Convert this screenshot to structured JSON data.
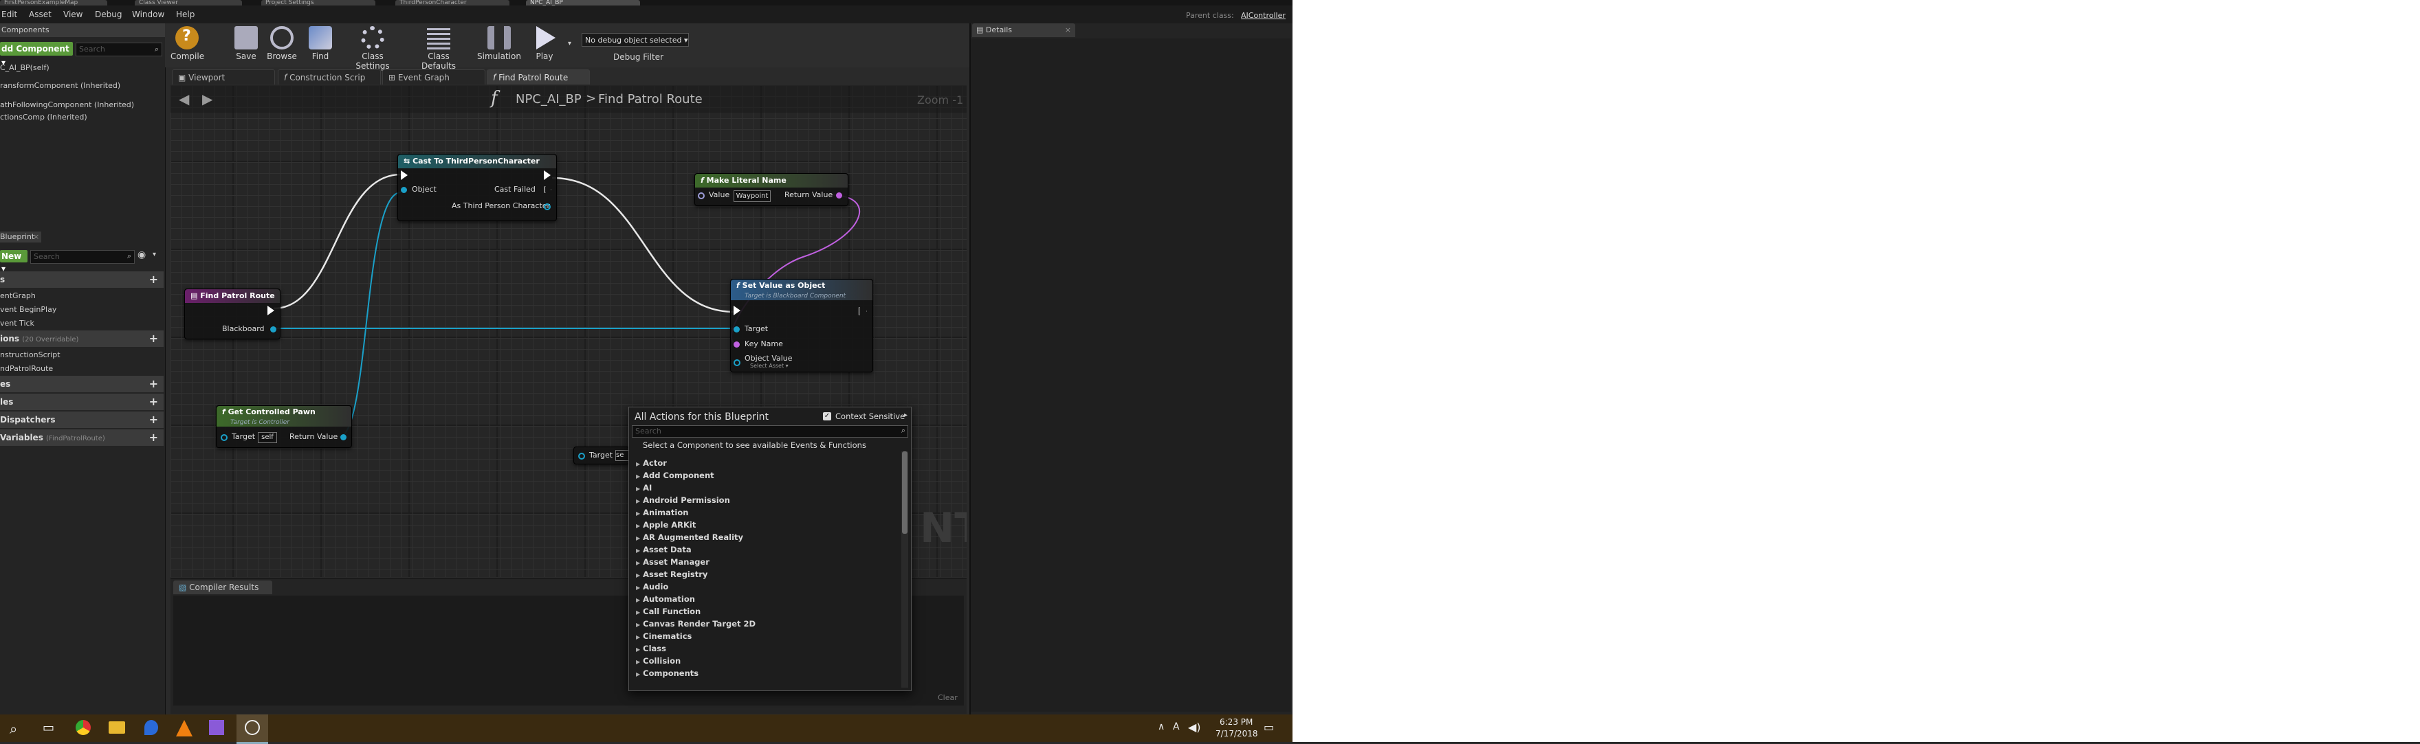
{
  "window_tabs": [
    "FirstPersonExampleMap",
    "Class Viewer",
    "Project Settings",
    "ThirdPersonCharacter",
    "NPC_AI_BP"
  ],
  "menu": [
    "Edit",
    "Asset",
    "View",
    "Debug",
    "Window",
    "Help"
  ],
  "parent_class": {
    "label": "Parent class:",
    "value": "AIController"
  },
  "components_panel": {
    "title": "Components",
    "add_component_label": "dd Component ▾",
    "search_placeholder": "Search",
    "items": [
      "C_AI_BP(self)",
      "ransformComponent (Inherited)",
      "athFollowingComponent (Inherited)",
      "ctionsComp (Inherited)"
    ]
  },
  "toolbar": {
    "compile": "Compile",
    "save": "Save",
    "browse": "Browse",
    "find": "Find",
    "class_settings": "Class Settings",
    "class_defaults": "Class Defaults",
    "simulation": "Simulation",
    "play": "Play",
    "debug_select": "No debug object selected ▾",
    "debug_filter": "Debug Filter"
  },
  "editor_tabs": [
    "Viewport",
    "Construction Scrip",
    "Event Graph",
    "Find Patrol Route"
  ],
  "graph": {
    "breadcrumb_fn": "NPC_AI_BP",
    "breadcrumb_sep": ">",
    "breadcrumb_name": "Find Patrol Route",
    "zoom": "Zoom -1",
    "watermark": "NT"
  },
  "nodes": {
    "cast": {
      "title": "Cast To ThirdPersonCharacter",
      "object": "Object",
      "cast_failed": "Cast Failed",
      "as_char": "As Third Person Character"
    },
    "literal": {
      "title": "Make Literal Name",
      "value_label": "Value",
      "value": "Waypoint",
      "return_value": "Return Value"
    },
    "set_value": {
      "title": "Set Value as Object",
      "subtitle": "Target is Blackboard Component",
      "target": "Target",
      "key_name": "Key Name",
      "object_value": "Object Value",
      "select_asset": "Select Asset ▾"
    },
    "find_route": {
      "title": "Find Patrol Route",
      "blackboard": "Blackboard"
    },
    "controlled_pawn": {
      "title": "Get Controlled Pawn",
      "subtitle": "Target is Controller",
      "target": "Target",
      "self": "self",
      "return_value": "Return Value"
    },
    "partial": {
      "target": "Target",
      "self": "se"
    }
  },
  "my_blueprint": {
    "title": "Blueprint",
    "new_label": "New ▾",
    "search_placeholder": "Search",
    "sections": [
      {
        "label": "s",
        "items": [
          "entGraph",
          "vent BeginPlay",
          "vent Tick"
        ]
      },
      {
        "label": "ions",
        "extra": "(20 Overridable)",
        "items": [
          "nstructionScript",
          "ndPatrolRoute"
        ]
      },
      {
        "label": "es",
        "items": []
      },
      {
        "label": "les",
        "items": []
      },
      {
        "label": "Dispatchers",
        "items": []
      },
      {
        "label": "Variables",
        "extra": "(FindPatrolRoute)",
        "items": []
      }
    ]
  },
  "action_menu": {
    "title": "All Actions for this Blueprint",
    "context_label": "Context Sensitive",
    "context_checked": true,
    "search_placeholder": "Search",
    "hint": "Select a Component to see available Events & Functions",
    "items": [
      "Actor",
      "Add Component",
      "AI",
      "Android Permission",
      "Animation",
      "Apple ARKit",
      "AR Augmented Reality",
      "Asset Data",
      "Asset Manager",
      "Asset Registry",
      "Audio",
      "Automation",
      "Call Function",
      "Canvas Render Target 2D",
      "Cinematics",
      "Class",
      "Collision",
      "Components"
    ]
  },
  "compiler": {
    "tab": "Compiler Results",
    "clear": "Clear"
  },
  "details": {
    "tab": "Details"
  },
  "taskbar": {
    "time": "6:23 PM",
    "date": "7/17/2018"
  }
}
